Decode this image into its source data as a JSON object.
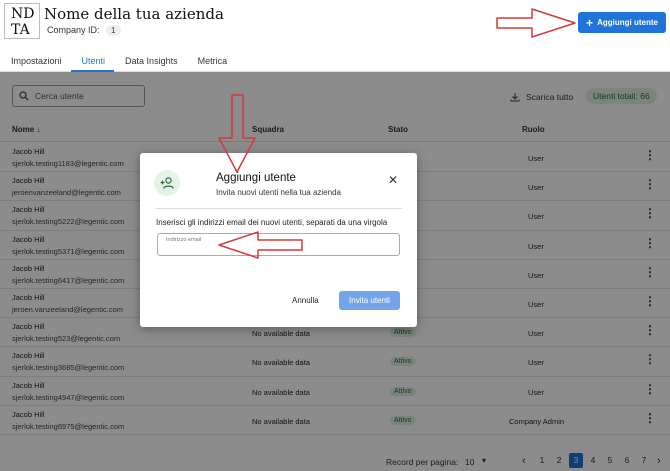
{
  "header": {
    "logo_line1": "ND",
    "logo_line2": "TA",
    "company_name": "Nome della tua azienda",
    "company_id_label": "Company ID:",
    "company_id_value": "1",
    "add_button_label": "Aggiungi utente"
  },
  "tabs": [
    {
      "label": "Impostazioni"
    },
    {
      "label": "Utenti",
      "active": true
    },
    {
      "label": "Data Insights"
    },
    {
      "label": "Metrica"
    }
  ],
  "toolbar": {
    "search_placeholder": "Cerca utente",
    "download_label": "Scarica tutto",
    "total_users": "Utenti totali: 66"
  },
  "table": {
    "columns": [
      "Nome ↓",
      "Squadra",
      "Stato",
      "Ruolo"
    ],
    "rows": [
      {
        "name": "Jacob Hill",
        "email": "sjerlok.testing1183@legentic.com",
        "team": "",
        "status": "",
        "role": "User"
      },
      {
        "name": "Jacob Hill",
        "email": "jeroenvanzeeland@legentic.com",
        "team": "",
        "status": "",
        "role": "User"
      },
      {
        "name": "Jacob Hill",
        "email": "sjerlok.testing5222@legentic.com",
        "team": "",
        "status": "",
        "role": "User"
      },
      {
        "name": "Jacob Hill",
        "email": "sjerlok.testing5371@legentic.com",
        "team": "",
        "status": "",
        "role": "User"
      },
      {
        "name": "Jacob Hill",
        "email": "sjerlok.testing6417@legentic.com",
        "team": "",
        "status": "",
        "role": "User"
      },
      {
        "name": "Jacob Hill",
        "email": "jeroen.vanzeeland@legentic.com",
        "team": "",
        "status": "",
        "role": "User"
      },
      {
        "name": "Jacob Hill",
        "email": "sjerlok.testing523@legentic.com",
        "team": "No available data",
        "status": "Attivo",
        "role": "User"
      },
      {
        "name": "Jacob Hill",
        "email": "sjerlok.testing3685@legentic.com",
        "team": "No available data",
        "status": "Attivo",
        "role": "User"
      },
      {
        "name": "Jacob Hill",
        "email": "sjerlok.testing4947@legentic.com",
        "team": "No available data",
        "status": "Attivo",
        "role": "User"
      },
      {
        "name": "Jacob Hill",
        "email": "sjerlok.testing6975@legentic.com",
        "team": "No available data",
        "status": "Attivo",
        "role": "Company Admin"
      }
    ]
  },
  "pagination": {
    "rows_per_page_label": "Record per pagina:",
    "rows_per_page_value": "10",
    "pages": [
      "1",
      "2",
      "3",
      "4",
      "5",
      "6",
      "7"
    ],
    "current_page": "3"
  },
  "modal": {
    "title": "Aggiungi utente",
    "subtitle": "Invita nuovi utenti nella tua azienda",
    "instructions": "Inserisci gli indirizzi email dei nuovi utenti, separati da una virgola",
    "email_placeholder": "Indirizzo email",
    "cancel_label": "Annulla",
    "invite_label": "Invita utenti"
  },
  "colors": {
    "primary": "#1e74d8",
    "annotation": "#d23a3a",
    "active_badge_bg": "#dff1e2"
  }
}
